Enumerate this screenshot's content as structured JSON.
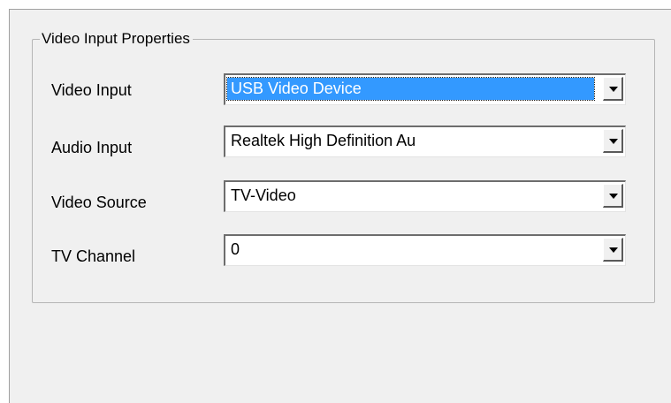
{
  "group": {
    "title": "Video Input Properties"
  },
  "fields": [
    {
      "label": "Video Input",
      "value": "USB Video Device",
      "selected": true
    },
    {
      "label": "Audio Input",
      "value": "Realtek High Definition Au",
      "selected": false
    },
    {
      "label": "Video Source",
      "value": "TV-Video",
      "selected": false
    },
    {
      "label": "TV Channel",
      "value": "0",
      "selected": false
    }
  ],
  "icons": {
    "dropdown": "chevron-down-icon"
  },
  "colors": {
    "window_bg": "#f0f0f0",
    "selection_bg": "#3399ff",
    "selection_text": "#ffffff"
  }
}
